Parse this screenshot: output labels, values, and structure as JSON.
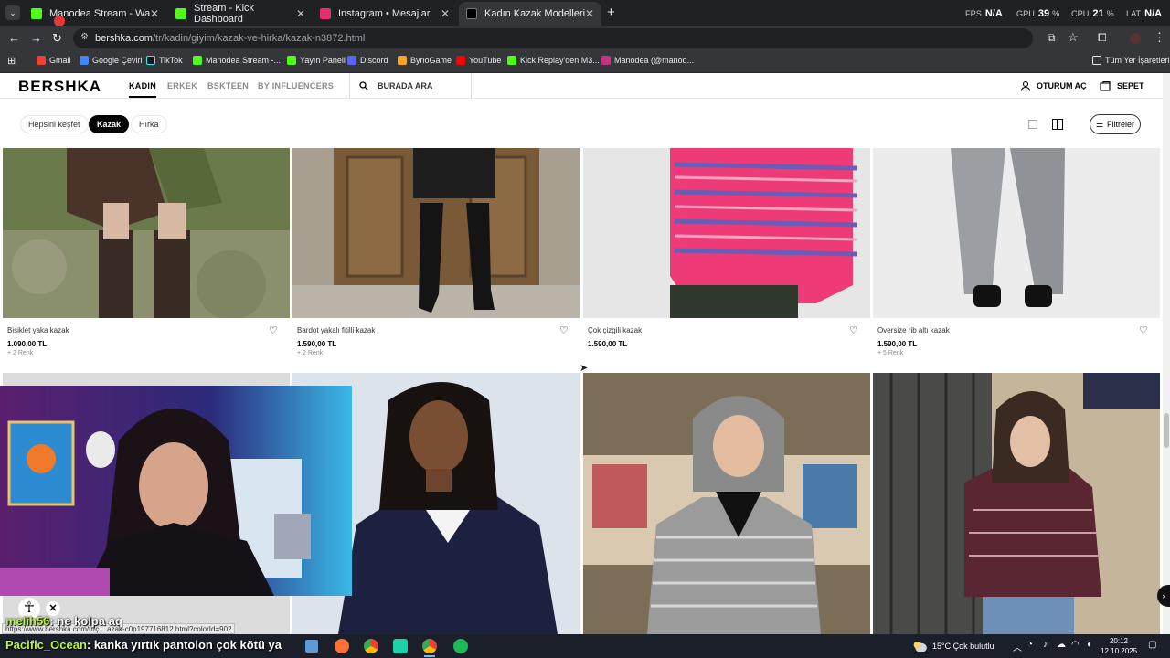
{
  "browser": {
    "tabs": [
      {
        "title": "Manodea Stream - Watch Live o",
        "favicon": "kick-icon",
        "color": "#53fc18"
      },
      {
        "title": "Stream - Kick Dashboard",
        "favicon": "kick-icon",
        "color": "#53fc18"
      },
      {
        "title": "Instagram • Mesajlar",
        "favicon": "instagram-icon",
        "color": "#e1306c"
      },
      {
        "title": "Kadın Kazak Modelleri | Yeni Ko",
        "favicon": "bershka-icon",
        "color": "#000000"
      }
    ],
    "url_host": "bershka.com",
    "url_path": "/tr/kadin/giyim/kazak-ve-hirka/kazak-n3872.html",
    "bookmarks": [
      "Gmail",
      "Google Çeviri",
      "TikTok",
      "Manodea Stream -...",
      "Yayın Paneli",
      "Discord",
      "BynoGame",
      "YouTube",
      "Kick Replay'den M3...",
      "Manodea (@manod..."
    ],
    "all_bookmarks": "Tüm Yer İşaretleri",
    "hud": {
      "fps_label": "FPS",
      "fps": "N/A",
      "gpu_label": "GPU",
      "gpu": "39",
      "cpu_label": "CPU",
      "cpu": "21",
      "lat_label": "LAT",
      "lat": "N/A",
      "percent": "%"
    }
  },
  "site": {
    "logo": "BERSHKA",
    "nav": [
      "KADIN",
      "ERKEK",
      "BSKTEEN",
      "BY INFLUENCERS"
    ],
    "search_placeholder": "BURADA ARA",
    "login": "OTURUM AÇ",
    "cart": "SEPET",
    "chips": [
      "Hepsini keşfet",
      "Kazak",
      "Hırka"
    ],
    "filter_label": "Filtreler"
  },
  "products": [
    {
      "name": "Bisiklet yaka kazak",
      "price": "1.090,00 TL",
      "extra": "+ 2 Renk"
    },
    {
      "name": "Bardot yakalı fitilli kazak",
      "price": "1.590,00 TL",
      "extra": "+ 2 Renk"
    },
    {
      "name": "Çok çizgili kazak",
      "price": "1.590,00 TL",
      "extra": ""
    },
    {
      "name": "Oversize rib altı kazak",
      "price": "1.590,00 TL",
      "extra": "+ 5 Renk"
    }
  ],
  "overlay": {
    "status_url": "https://www.bershka.com/tr/ç... azak-c0p197716812.html?colorId=902",
    "chat": [
      {
        "user": "melih56",
        "message": ": ne kolpa aq"
      },
      {
        "user": "Pacific_Ocean",
        "message": ": kanka yırtık pantolon çok kötü ya"
      }
    ]
  },
  "taskbar": {
    "weather": "15°C  Çok bulutlu",
    "time": "20:12",
    "date": "12.10.2025"
  }
}
